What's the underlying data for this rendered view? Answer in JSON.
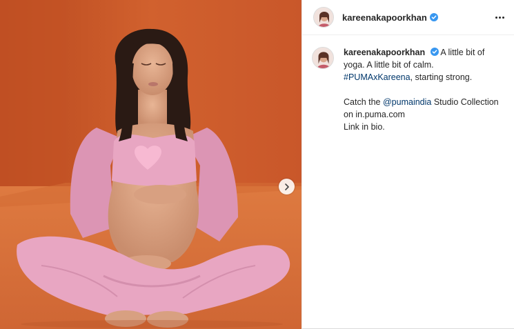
{
  "post": {
    "username": "kareenakapoorkhan",
    "verified": true,
    "caption": {
      "line1": "A little bit of yoga. A little bit of calm.",
      "hashtag": "#PUMAxKareena",
      "line1_end": ", starting strong.",
      "catch_prefix": "Catch the ",
      "mention": "@pumaindia",
      "catch_rest": " Studio Collection on in.puma.com",
      "link_in_bio": "Link in bio."
    }
  },
  "colors": {
    "backdrop": "#c8582a",
    "outfit": "#e8a6c2",
    "verified_badge": "#3897f0",
    "link": "#00376b"
  },
  "icons": {
    "next": "chevron-right-icon",
    "more": "more-options-icon",
    "verified": "verified-badge-icon"
  }
}
